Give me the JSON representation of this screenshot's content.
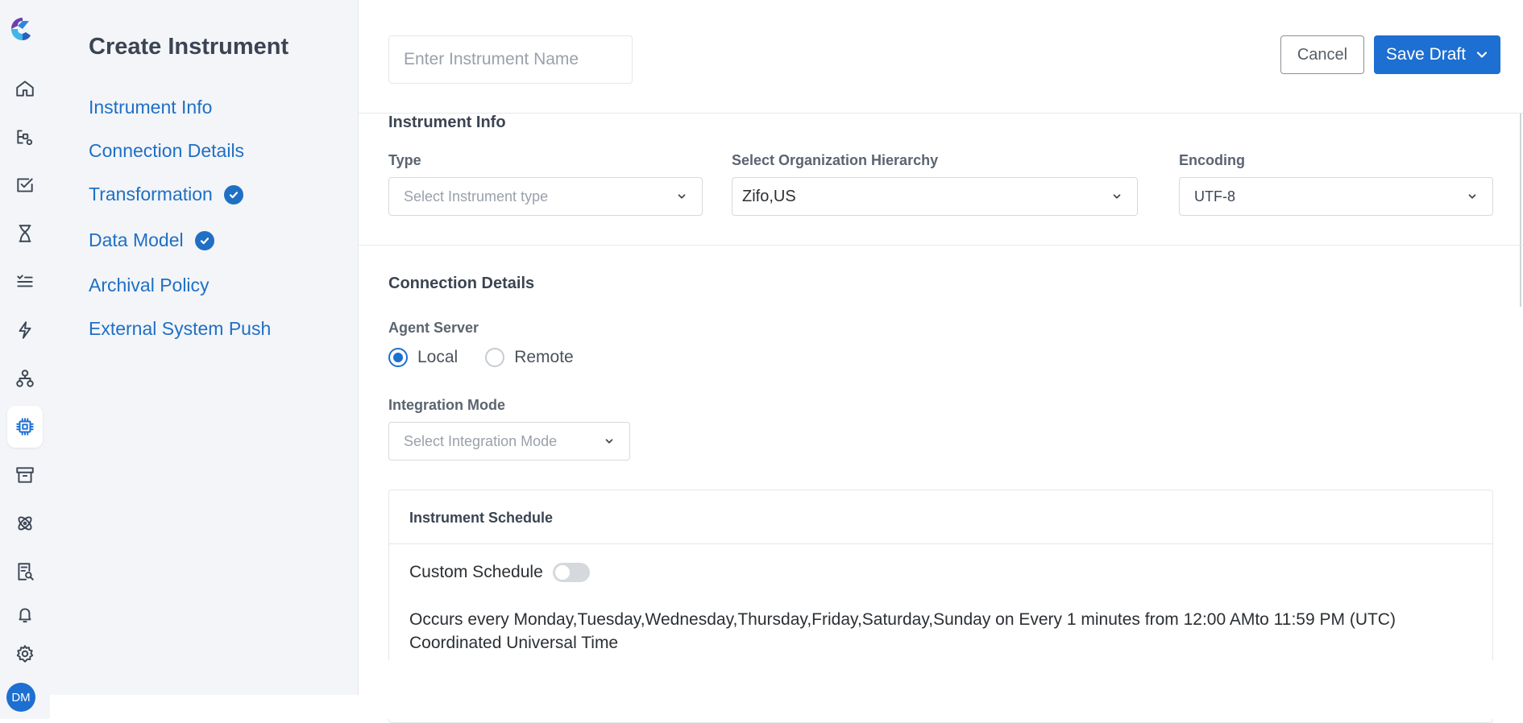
{
  "sidebar_nav": {
    "title": "Create Instrument",
    "items": [
      {
        "label": "Instrument Info",
        "completed": false
      },
      {
        "label": "Connection Details",
        "completed": false
      },
      {
        "label": "Transformation",
        "completed": true
      },
      {
        "label": "Data Model",
        "completed": true
      },
      {
        "label": "Archival Policy",
        "completed": false
      },
      {
        "label": "External System Push",
        "completed": false
      }
    ]
  },
  "rail": {
    "icons": [
      "home-icon",
      "workflow-icon",
      "checklist-icon",
      "hourglass-icon",
      "list-icon",
      "lightning-icon",
      "hierarchy-icon",
      "chip-icon",
      "archive-icon",
      "atom-icon",
      "report-search-icon",
      "bell-icon",
      "gear-icon"
    ],
    "active": "chip-icon",
    "avatar_initials": "DM"
  },
  "header": {
    "name_placeholder": "Enter Instrument Name",
    "cancel_label": "Cancel",
    "save_label": "Save Draft"
  },
  "instrument_info": {
    "title": "Instrument Info",
    "type_label": "Type",
    "type_placeholder": "Select Instrument type",
    "org_label": "Select Organization Hierarchy",
    "org_value": "Zifo,US",
    "encoding_label": "Encoding",
    "encoding_value": "UTF-8"
  },
  "connection": {
    "title": "Connection Details",
    "agent_label": "Agent Server",
    "agent_options": [
      "Local",
      "Remote"
    ],
    "agent_selected": "Local",
    "mode_label": "Integration Mode",
    "mode_placeholder": "Select Integration Mode"
  },
  "schedule": {
    "title": "Instrument Schedule",
    "custom_label": "Custom Schedule",
    "custom_enabled": false,
    "description": "Occurs every Monday,Tuesday,Wednesday,Thursday,Friday,Saturday,Sunday on Every 1 minutes from 12:00 AMto 11:59 PM (UTC) Coordinated Universal Time"
  },
  "colors": {
    "accent": "#1d6fd1",
    "nav_link": "#1f6fc5",
    "sidebar_bg": "#f3f5f8"
  }
}
